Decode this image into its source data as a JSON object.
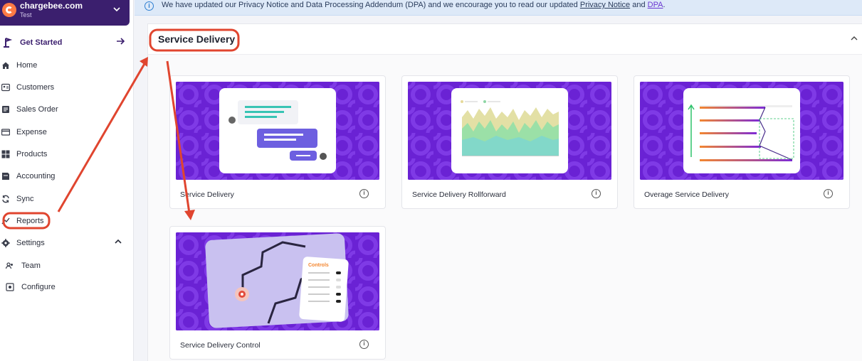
{
  "org": {
    "name": "chargebee.com",
    "sub": "Test"
  },
  "get_started": {
    "label": "Get Started"
  },
  "nav": [
    {
      "label": "Home",
      "icon": "home-icon"
    },
    {
      "label": "Customers",
      "icon": "customers-icon"
    },
    {
      "label": "Sales Order",
      "icon": "sales-order-icon"
    },
    {
      "label": "Expense",
      "icon": "expense-icon"
    },
    {
      "label": "Products",
      "icon": "products-icon"
    },
    {
      "label": "Accounting",
      "icon": "accounting-icon"
    },
    {
      "label": "Sync",
      "icon": "sync-icon"
    },
    {
      "label": "Reports",
      "icon": "reports-icon"
    },
    {
      "label": "Settings",
      "icon": "gear-icon"
    }
  ],
  "settings_sub": [
    {
      "label": "Team",
      "icon": "team-icon"
    },
    {
      "label": "Configure",
      "icon": "configure-icon"
    }
  ],
  "banner": {
    "text": "We have updated our Privacy Notice and Data Processing Addendum (DPA) and we encourage you to read our updated",
    "link1": "Privacy Notice",
    "and": "and",
    "link2": "DPA",
    "end": "."
  },
  "section": {
    "title": "Service Delivery"
  },
  "cards": [
    {
      "label": "Service Delivery"
    },
    {
      "label": "Service Delivery Rollforward"
    },
    {
      "label": "Overage Service Delivery"
    },
    {
      "label": "Service Delivery Control"
    }
  ],
  "controls_panel": {
    "title": "Controls"
  },
  "colors": {
    "brand": "#3b1f6e",
    "accent": "#6a22d4",
    "highlight": "#e0452f",
    "chargebee": "#ff7a45"
  }
}
